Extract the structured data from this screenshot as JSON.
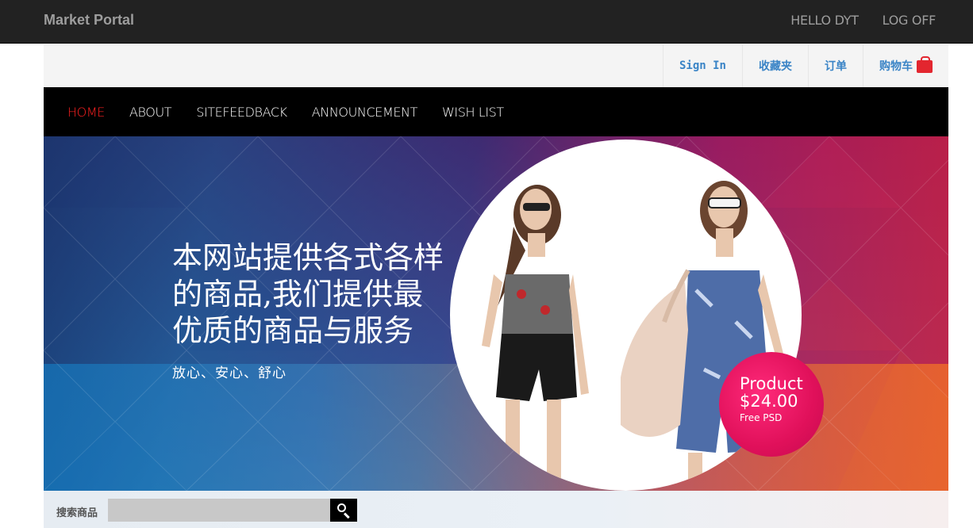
{
  "topbar": {
    "brand": "Market Portal",
    "greeting": "HELLO DYT",
    "logoff": "LOG OFF"
  },
  "utility": {
    "signin": "Sign In",
    "favorites": "收藏夹",
    "orders": "订单",
    "cart": "购物车",
    "cart_icon": "shopping-bag-icon",
    "link_color": "#3a84c6"
  },
  "nav": {
    "items": [
      {
        "label": "HOME",
        "active": true
      },
      {
        "label": "ABOUT",
        "active": false
      },
      {
        "label": "SITEFEEDBACK",
        "active": false
      },
      {
        "label": "ANNOUNCEMENT",
        "active": false
      },
      {
        "label": "WISH LIST",
        "active": false
      }
    ],
    "active_color": "#ff2020"
  },
  "hero": {
    "headline_lines": [
      "本网站提供各式各样",
      "的商品,我们提供最",
      "优质的商品与服务"
    ],
    "subline": "放心、安心、舒心",
    "badge": {
      "title": "Product",
      "price": "$24.00",
      "note": "Free PSD",
      "color": "#e0105a"
    }
  },
  "search": {
    "label": "搜索商品",
    "value": "",
    "placeholder": "",
    "button_icon": "search-icon"
  }
}
